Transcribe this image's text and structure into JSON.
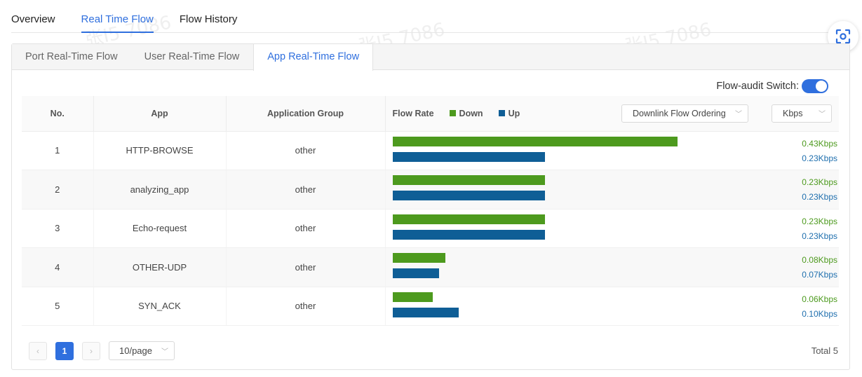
{
  "watermark_text": "张I5 7086",
  "tabs": [
    {
      "label": "Overview"
    },
    {
      "label": "Real Time Flow"
    },
    {
      "label": "Flow History"
    }
  ],
  "sub_tabs": [
    {
      "label": "Port Real-Time Flow"
    },
    {
      "label": "User Real-Time Flow"
    },
    {
      "label": "App Real-Time Flow"
    }
  ],
  "flow_audit": {
    "label": "Flow-audit Switch:",
    "enabled": true
  },
  "table": {
    "headers": {
      "no": "No.",
      "app": "App",
      "group": "Application Group",
      "rate": "Flow Rate"
    },
    "legend": {
      "down": "Down",
      "up": "Up"
    },
    "ordering_select": "Downlink Flow Ordering",
    "unit_select": "Kbps",
    "max_rate_kbps": 0.62,
    "rows": [
      {
        "no": "1",
        "app": "HTTP-BROWSE",
        "group": "other",
        "down": 0.43,
        "up": 0.23,
        "down_label": "0.43Kbps",
        "up_label": "0.23Kbps"
      },
      {
        "no": "2",
        "app": "analyzing_app",
        "group": "other",
        "down": 0.23,
        "up": 0.23,
        "down_label": "0.23Kbps",
        "up_label": "0.23Kbps"
      },
      {
        "no": "3",
        "app": "Echo-request",
        "group": "other",
        "down": 0.23,
        "up": 0.23,
        "down_label": "0.23Kbps",
        "up_label": "0.23Kbps"
      },
      {
        "no": "4",
        "app": "OTHER-UDP",
        "group": "other",
        "down": 0.08,
        "up": 0.07,
        "down_label": "0.08Kbps",
        "up_label": "0.07Kbps"
      },
      {
        "no": "5",
        "app": "SYN_ACK",
        "group": "other",
        "down": 0.06,
        "up": 0.1,
        "down_label": "0.06Kbps",
        "up_label": "0.10Kbps"
      }
    ]
  },
  "pagination": {
    "prev": "‹",
    "current": "1",
    "next": "›",
    "page_size": "10/page",
    "total": "Total 5"
  },
  "colors": {
    "accent": "#2f6fde",
    "down": "#4d9a1e",
    "up": "#0f5e96",
    "down_text": "#4d9a1e",
    "up_text": "#1f6fae"
  }
}
